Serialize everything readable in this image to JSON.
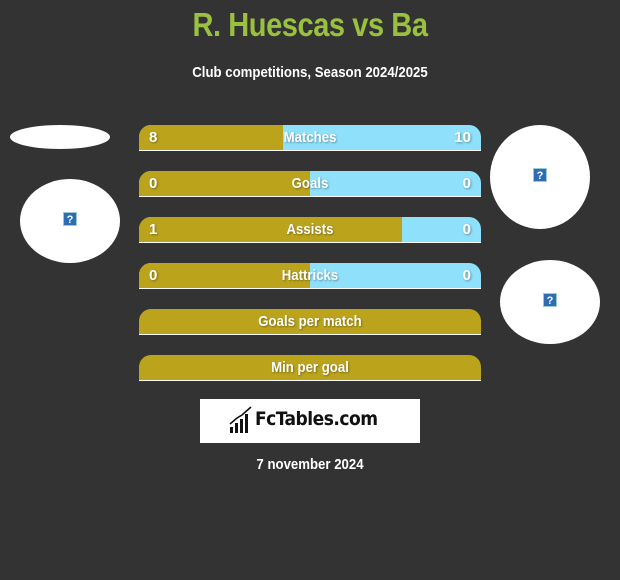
{
  "header": {
    "title": "R. Huescas vs Ba",
    "subtitle": "Club competitions, Season 2024/2025"
  },
  "colors": {
    "title": "#9ac040",
    "left_fill": "#bba41c",
    "right_fill": "#8fe0fb",
    "background": "#333333"
  },
  "stats": [
    {
      "label": "Matches",
      "left": "8",
      "right": "10",
      "left_share": 0.42
    },
    {
      "label": "Goals",
      "left": "0",
      "right": "0",
      "left_share": 0.5
    },
    {
      "label": "Assists",
      "left": "1",
      "right": "0",
      "left_share": 0.77
    },
    {
      "label": "Hattricks",
      "left": "0",
      "right": "0",
      "left_share": 0.5
    },
    {
      "label": "Goals per match"
    },
    {
      "label": "Min per goal"
    }
  ],
  "logos": {
    "placeholder_glyph": "?"
  },
  "brand": {
    "name": "FcTables.com"
  },
  "footer": {
    "date": "7 november 2024"
  }
}
